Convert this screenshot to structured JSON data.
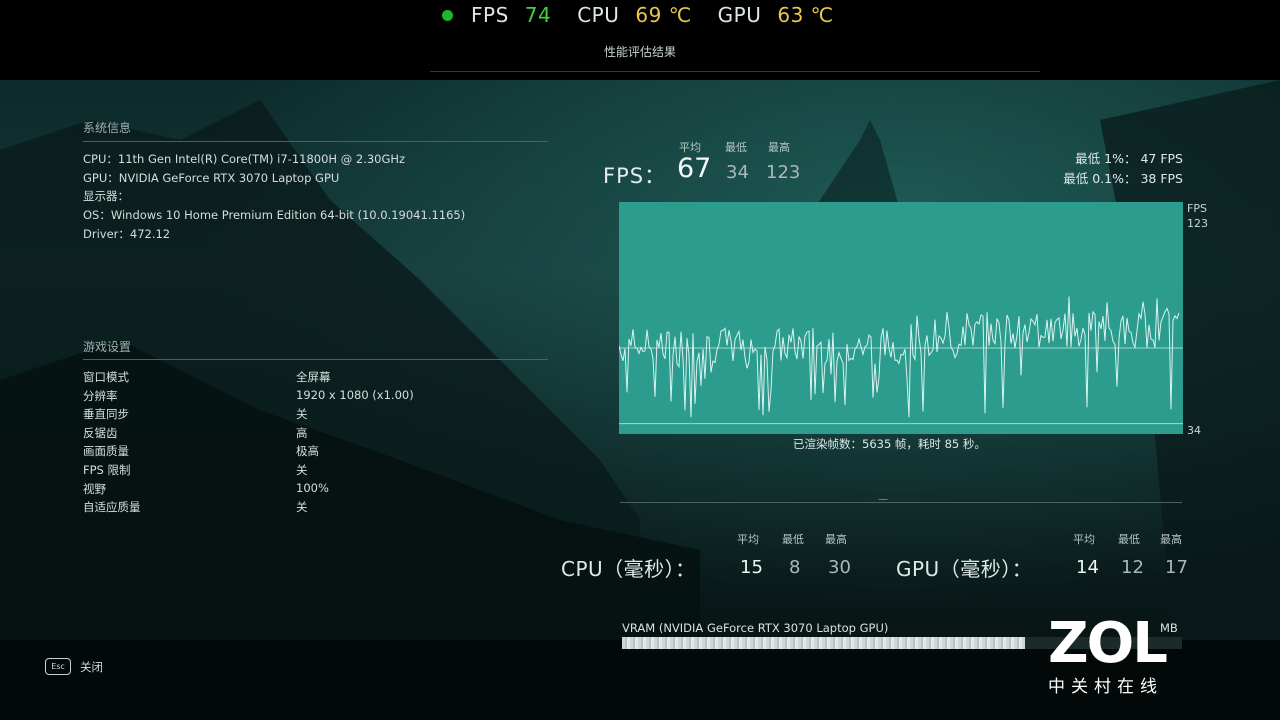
{
  "hud": {
    "fps_label": "FPS",
    "fps_value": "74",
    "cpu_label": "CPU",
    "cpu_value": "69 ℃",
    "gpu_label": "GPU",
    "gpu_value": "63 ℃"
  },
  "title": "性能评估结果",
  "system": {
    "heading": "系统信息",
    "cpu": "CPU：11th Gen Intel(R) Core(TM) i7-11800H @ 2.30GHz",
    "gpu": "GPU：NVIDIA GeForce RTX 3070 Laptop GPU",
    "display": "显示器：",
    "os": "OS：Windows 10 Home Premium Edition 64-bit (10.0.19041.1165)",
    "driver": "Driver：472.12"
  },
  "settings": {
    "heading": "游戏设置",
    "rows": [
      {
        "label": "窗口模式",
        "value": "全屏幕"
      },
      {
        "label": "分辨率",
        "value": "1920 x 1080 (x1.00)"
      },
      {
        "label": "垂直同步",
        "value": "关"
      },
      {
        "label": "反锯齿",
        "value": "高"
      },
      {
        "label": "画面质量",
        "value": "极高"
      },
      {
        "label": "FPS 限制",
        "value": "关"
      },
      {
        "label": "视野",
        "value": "100%"
      },
      {
        "label": "自适应质量",
        "value": "关"
      }
    ]
  },
  "fps": {
    "label": "FPS：",
    "col_avg": "平均",
    "col_min": "最低",
    "col_max": "最高",
    "avg": "67",
    "min": "34",
    "max": "123",
    "low1": "最低 1%：  47 FPS",
    "low01": "最低 0.1%：  38 FPS",
    "axis_unit": "FPS",
    "axis_top": "123",
    "axis_bottom": "34",
    "frames_text": "已渲染帧数：5635 帧，耗时 85 秒。"
  },
  "cpu_ms": {
    "label": "CPU（毫秒）：",
    "col_avg": "平均",
    "col_min": "最低",
    "col_max": "最高",
    "avg": "15",
    "min": "8",
    "max": "30"
  },
  "gpu_ms": {
    "label": "GPU（毫秒）：",
    "col_avg": "平均",
    "col_min": "最低",
    "col_max": "最高",
    "avg": "14",
    "min": "12",
    "max": "17"
  },
  "vram": {
    "label": "VRAM (NVIDIA GeForce RTX 3070 Laptop GPU)",
    "unit": "MB",
    "used_fraction": 0.72
  },
  "footer": {
    "esc_key": "Esc",
    "close_label": "关闭"
  },
  "logo": {
    "brand": "ZOL",
    "subtitle": "中关村在线"
  },
  "colors": {
    "fps_green": "#3fd23f",
    "temp_yellow": "#e8c84a",
    "chart_bg": "#2c9c8f",
    "chart_line": "#d9f3ef",
    "status_dot": "#27b527"
  },
  "chart_data": {
    "type": "line",
    "title": "",
    "ylabel": "FPS",
    "ylim": [
      34,
      123
    ],
    "avg": 67,
    "min": 34,
    "max": 123
  }
}
